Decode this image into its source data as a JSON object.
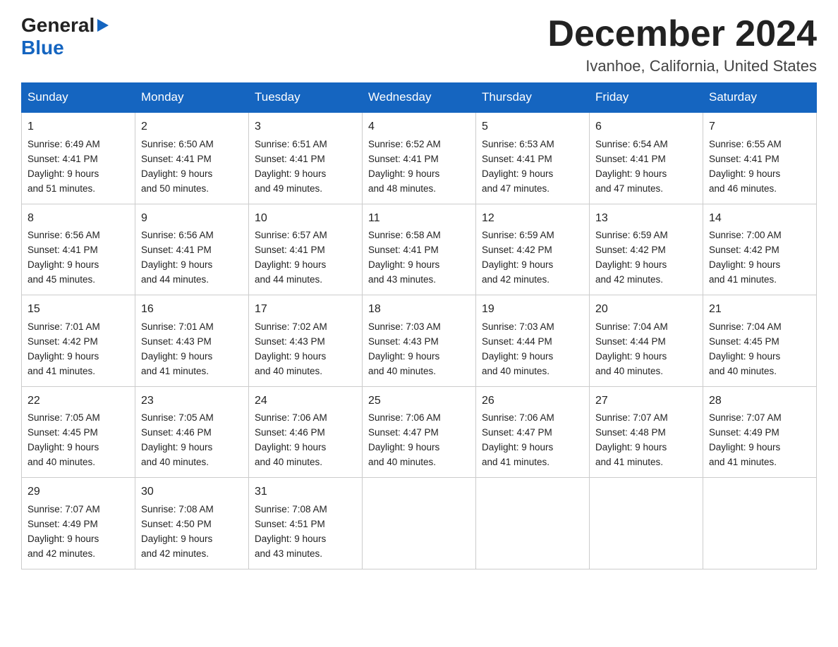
{
  "header": {
    "logo_general": "General",
    "logo_blue": "Blue",
    "month_title": "December 2024",
    "location": "Ivanhoe, California, United States"
  },
  "calendar": {
    "days": [
      "Sunday",
      "Monday",
      "Tuesday",
      "Wednesday",
      "Thursday",
      "Friday",
      "Saturday"
    ],
    "weeks": [
      [
        {
          "day": "1",
          "sunrise": "6:49 AM",
          "sunset": "4:41 PM",
          "daylight": "9 hours and 51 minutes."
        },
        {
          "day": "2",
          "sunrise": "6:50 AM",
          "sunset": "4:41 PM",
          "daylight": "9 hours and 50 minutes."
        },
        {
          "day": "3",
          "sunrise": "6:51 AM",
          "sunset": "4:41 PM",
          "daylight": "9 hours and 49 minutes."
        },
        {
          "day": "4",
          "sunrise": "6:52 AM",
          "sunset": "4:41 PM",
          "daylight": "9 hours and 48 minutes."
        },
        {
          "day": "5",
          "sunrise": "6:53 AM",
          "sunset": "4:41 PM",
          "daylight": "9 hours and 47 minutes."
        },
        {
          "day": "6",
          "sunrise": "6:54 AM",
          "sunset": "4:41 PM",
          "daylight": "9 hours and 47 minutes."
        },
        {
          "day": "7",
          "sunrise": "6:55 AM",
          "sunset": "4:41 PM",
          "daylight": "9 hours and 46 minutes."
        }
      ],
      [
        {
          "day": "8",
          "sunrise": "6:56 AM",
          "sunset": "4:41 PM",
          "daylight": "9 hours and 45 minutes."
        },
        {
          "day": "9",
          "sunrise": "6:56 AM",
          "sunset": "4:41 PM",
          "daylight": "9 hours and 44 minutes."
        },
        {
          "day": "10",
          "sunrise": "6:57 AM",
          "sunset": "4:41 PM",
          "daylight": "9 hours and 44 minutes."
        },
        {
          "day": "11",
          "sunrise": "6:58 AM",
          "sunset": "4:41 PM",
          "daylight": "9 hours and 43 minutes."
        },
        {
          "day": "12",
          "sunrise": "6:59 AM",
          "sunset": "4:42 PM",
          "daylight": "9 hours and 42 minutes."
        },
        {
          "day": "13",
          "sunrise": "6:59 AM",
          "sunset": "4:42 PM",
          "daylight": "9 hours and 42 minutes."
        },
        {
          "day": "14",
          "sunrise": "7:00 AM",
          "sunset": "4:42 PM",
          "daylight": "9 hours and 41 minutes."
        }
      ],
      [
        {
          "day": "15",
          "sunrise": "7:01 AM",
          "sunset": "4:42 PM",
          "daylight": "9 hours and 41 minutes."
        },
        {
          "day": "16",
          "sunrise": "7:01 AM",
          "sunset": "4:43 PM",
          "daylight": "9 hours and 41 minutes."
        },
        {
          "day": "17",
          "sunrise": "7:02 AM",
          "sunset": "4:43 PM",
          "daylight": "9 hours and 40 minutes."
        },
        {
          "day": "18",
          "sunrise": "7:03 AM",
          "sunset": "4:43 PM",
          "daylight": "9 hours and 40 minutes."
        },
        {
          "day": "19",
          "sunrise": "7:03 AM",
          "sunset": "4:44 PM",
          "daylight": "9 hours and 40 minutes."
        },
        {
          "day": "20",
          "sunrise": "7:04 AM",
          "sunset": "4:44 PM",
          "daylight": "9 hours and 40 minutes."
        },
        {
          "day": "21",
          "sunrise": "7:04 AM",
          "sunset": "4:45 PM",
          "daylight": "9 hours and 40 minutes."
        }
      ],
      [
        {
          "day": "22",
          "sunrise": "7:05 AM",
          "sunset": "4:45 PM",
          "daylight": "9 hours and 40 minutes."
        },
        {
          "day": "23",
          "sunrise": "7:05 AM",
          "sunset": "4:46 PM",
          "daylight": "9 hours and 40 minutes."
        },
        {
          "day": "24",
          "sunrise": "7:06 AM",
          "sunset": "4:46 PM",
          "daylight": "9 hours and 40 minutes."
        },
        {
          "day": "25",
          "sunrise": "7:06 AM",
          "sunset": "4:47 PM",
          "daylight": "9 hours and 40 minutes."
        },
        {
          "day": "26",
          "sunrise": "7:06 AM",
          "sunset": "4:47 PM",
          "daylight": "9 hours and 41 minutes."
        },
        {
          "day": "27",
          "sunrise": "7:07 AM",
          "sunset": "4:48 PM",
          "daylight": "9 hours and 41 minutes."
        },
        {
          "day": "28",
          "sunrise": "7:07 AM",
          "sunset": "4:49 PM",
          "daylight": "9 hours and 41 minutes."
        }
      ],
      [
        {
          "day": "29",
          "sunrise": "7:07 AM",
          "sunset": "4:49 PM",
          "daylight": "9 hours and 42 minutes."
        },
        {
          "day": "30",
          "sunrise": "7:08 AM",
          "sunset": "4:50 PM",
          "daylight": "9 hours and 42 minutes."
        },
        {
          "day": "31",
          "sunrise": "7:08 AM",
          "sunset": "4:51 PM",
          "daylight": "9 hours and 43 minutes."
        },
        null,
        null,
        null,
        null
      ]
    ]
  }
}
